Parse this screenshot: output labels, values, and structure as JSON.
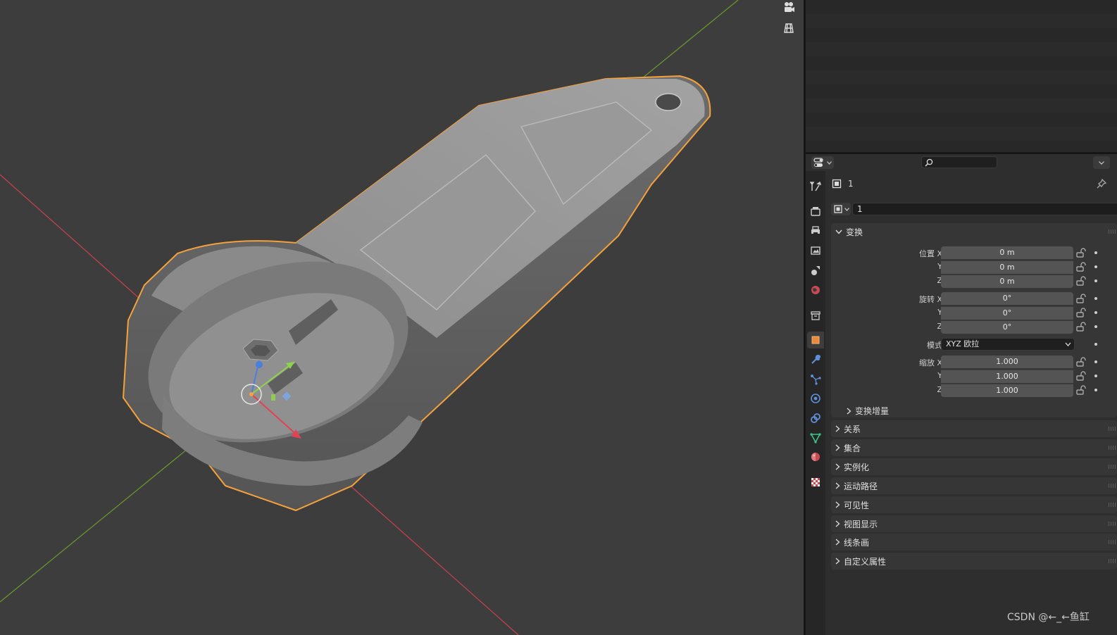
{
  "properties": {
    "search_placeholder": "",
    "object_name": "1",
    "datablock_name": "1",
    "transform": {
      "title": "变换",
      "location_label": "位置 X",
      "location": [
        "0 m",
        "0 m",
        "0 m"
      ],
      "rotation_label": "旋转 X",
      "rotation": [
        "0°",
        "0°",
        "0°"
      ],
      "mode_label": "模式",
      "mode_value": "XYZ 欧拉",
      "scale_label": "缩放 X",
      "scale": [
        "1.000",
        "1.000",
        "1.000"
      ],
      "axis_y": "Y",
      "axis_z": "Z",
      "delta_title": "变换增量"
    },
    "collapsed_panels": [
      "关系",
      "集合",
      "实例化",
      "运动路径",
      "可见性",
      "视图显示",
      "线条画",
      "自定义属性"
    ]
  },
  "watermark": "CSDN @←_←鱼缸",
  "colors": {
    "viewport_bg": "#3d3d3d",
    "selection_outline": "#f5a13c",
    "x_axis": "#c9424f",
    "y_axis": "#6c9a2a",
    "gizmo_blue": "#4a7fe0",
    "active_tab": "#e98a3c"
  }
}
